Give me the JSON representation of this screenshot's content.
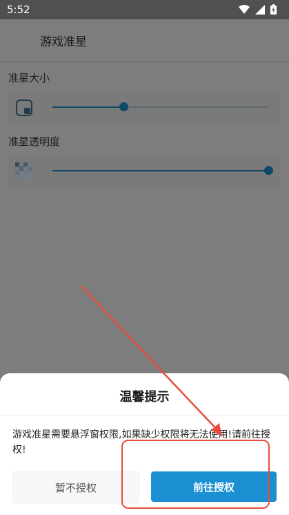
{
  "status_bar": {
    "time": "5:52"
  },
  "app_bar": {
    "title": "游戏准星"
  },
  "crosshair_size": {
    "label": "准星大小",
    "value_fraction": 0.33
  },
  "crosshair_opacity": {
    "label": "准星透明度",
    "value_fraction": 1.0
  },
  "dialog": {
    "title": "温馨提示",
    "message": "游戏准星需要悬浮窗权限,如果缺少权限将无法使用!请前往授权!",
    "cancel_label": "暂不授权",
    "confirm_label": "前往授权"
  },
  "colors": {
    "accent": "#1a8fd1",
    "slider": "#0e4a66",
    "annotation": "#e74c3c"
  }
}
